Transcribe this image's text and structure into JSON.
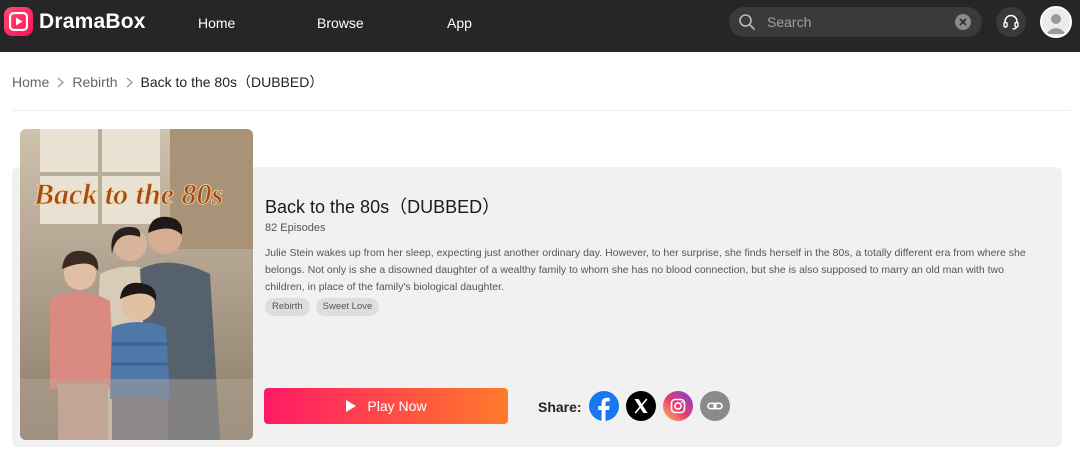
{
  "header": {
    "logo_text": "DramaBox",
    "nav": [
      {
        "label": "Home"
      },
      {
        "label": "Browse"
      },
      {
        "label": "App"
      }
    ],
    "search": {
      "placeholder": "Search",
      "value": ""
    },
    "icons": {
      "search": "search-icon",
      "clear": "clear-icon",
      "support": "headset-icon",
      "avatar": "user-avatar"
    }
  },
  "breadcrumb": {
    "items": [
      "Home",
      "Rebirth"
    ],
    "current": "Back to the 80s（DUBBED）"
  },
  "drama": {
    "poster_title": "Back to the 80s",
    "title": "Back to the 80s（DUBBED）",
    "episodes": "82 Episodes",
    "description": "Julie Stein wakes up from her sleep, expecting just another ordinary day. However, to her surprise, she finds herself in the 80s, a totally different era from where she belongs. Not only is she a disowned daughter of a wealthy family to whom she has no blood connection, but she is also supposed to marry an old man with two children, in place of the family's biological daughter.",
    "tags": [
      "Rebirth",
      "Sweet Love"
    ],
    "play_label": "Play Now"
  },
  "share": {
    "label": "Share:",
    "buttons": [
      {
        "name": "facebook-icon",
        "color": "#1877f2"
      },
      {
        "name": "x-icon",
        "color": "#000000"
      },
      {
        "name": "instagram-icon",
        "color": "#d6249f"
      },
      {
        "name": "link-icon",
        "color": "#8a8a8a"
      }
    ]
  },
  "colors": {
    "header_bg": "#262626",
    "accent_start": "#ff1a66",
    "accent_end": "#ff7a2a",
    "card_bg": "#f1f1f1"
  }
}
